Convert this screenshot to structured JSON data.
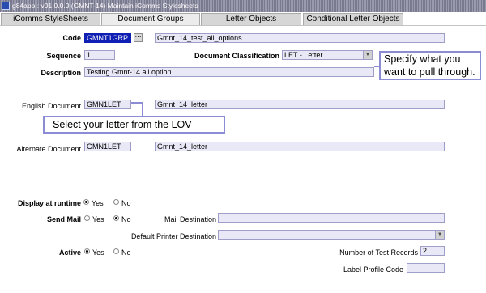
{
  "window": {
    "title": "g84app : v01.0.0.0 (GMNT-14) Maintain iComms Stylesheets"
  },
  "tabs": [
    {
      "label": "iComms StyleSheets"
    },
    {
      "label": "Document Groups"
    },
    {
      "label": "Letter Objects"
    },
    {
      "label": "Conditional Letter Objects"
    }
  ],
  "form": {
    "code_label": "Code",
    "code_value": "GMNT1GRP",
    "code_desc": "Gmnt_14_test_all_options",
    "sequence_label": "Sequence",
    "sequence_value": "1",
    "doc_class_label": "Document Classification",
    "doc_class_value": "LET - Letter",
    "description_label": "Description",
    "description_value": "Testing Gmnt-14 all option",
    "english_doc_label": "English Document",
    "english_doc_code": "GMN1LET",
    "english_doc_desc": "Gmnt_14_letter",
    "alt_doc_label": "Alternate Document",
    "alt_doc_code": "GMN1LET",
    "alt_doc_desc": "Gmnt_14_letter",
    "display_runtime_label": "Display at runtime",
    "send_mail_label": "Send Mail",
    "active_label": "Active",
    "yes": "Yes",
    "no": "No",
    "mail_dest_label": "Mail Destination",
    "mail_dest_value": "",
    "printer_dest_label": "Default Printer Destination",
    "printer_dest_value": "",
    "test_records_label": "Number of Test Records",
    "test_records_value": "2",
    "label_profile_label": "Label Profile Code",
    "label_profile_value": "",
    "display_runtime": "Yes",
    "send_mail": "No",
    "active": "Yes"
  },
  "callouts": {
    "specify": "Specify what you want to pull through.",
    "select_letter": "Select your letter from the LOV"
  },
  "icons": {
    "lov": "ellipsis-icon",
    "dropdown": "chevron-down-icon"
  },
  "colors": {
    "selected_field": "#0f1fb4",
    "field_bg": "#e8e8f6",
    "callout_border": "#8c8cd4"
  }
}
